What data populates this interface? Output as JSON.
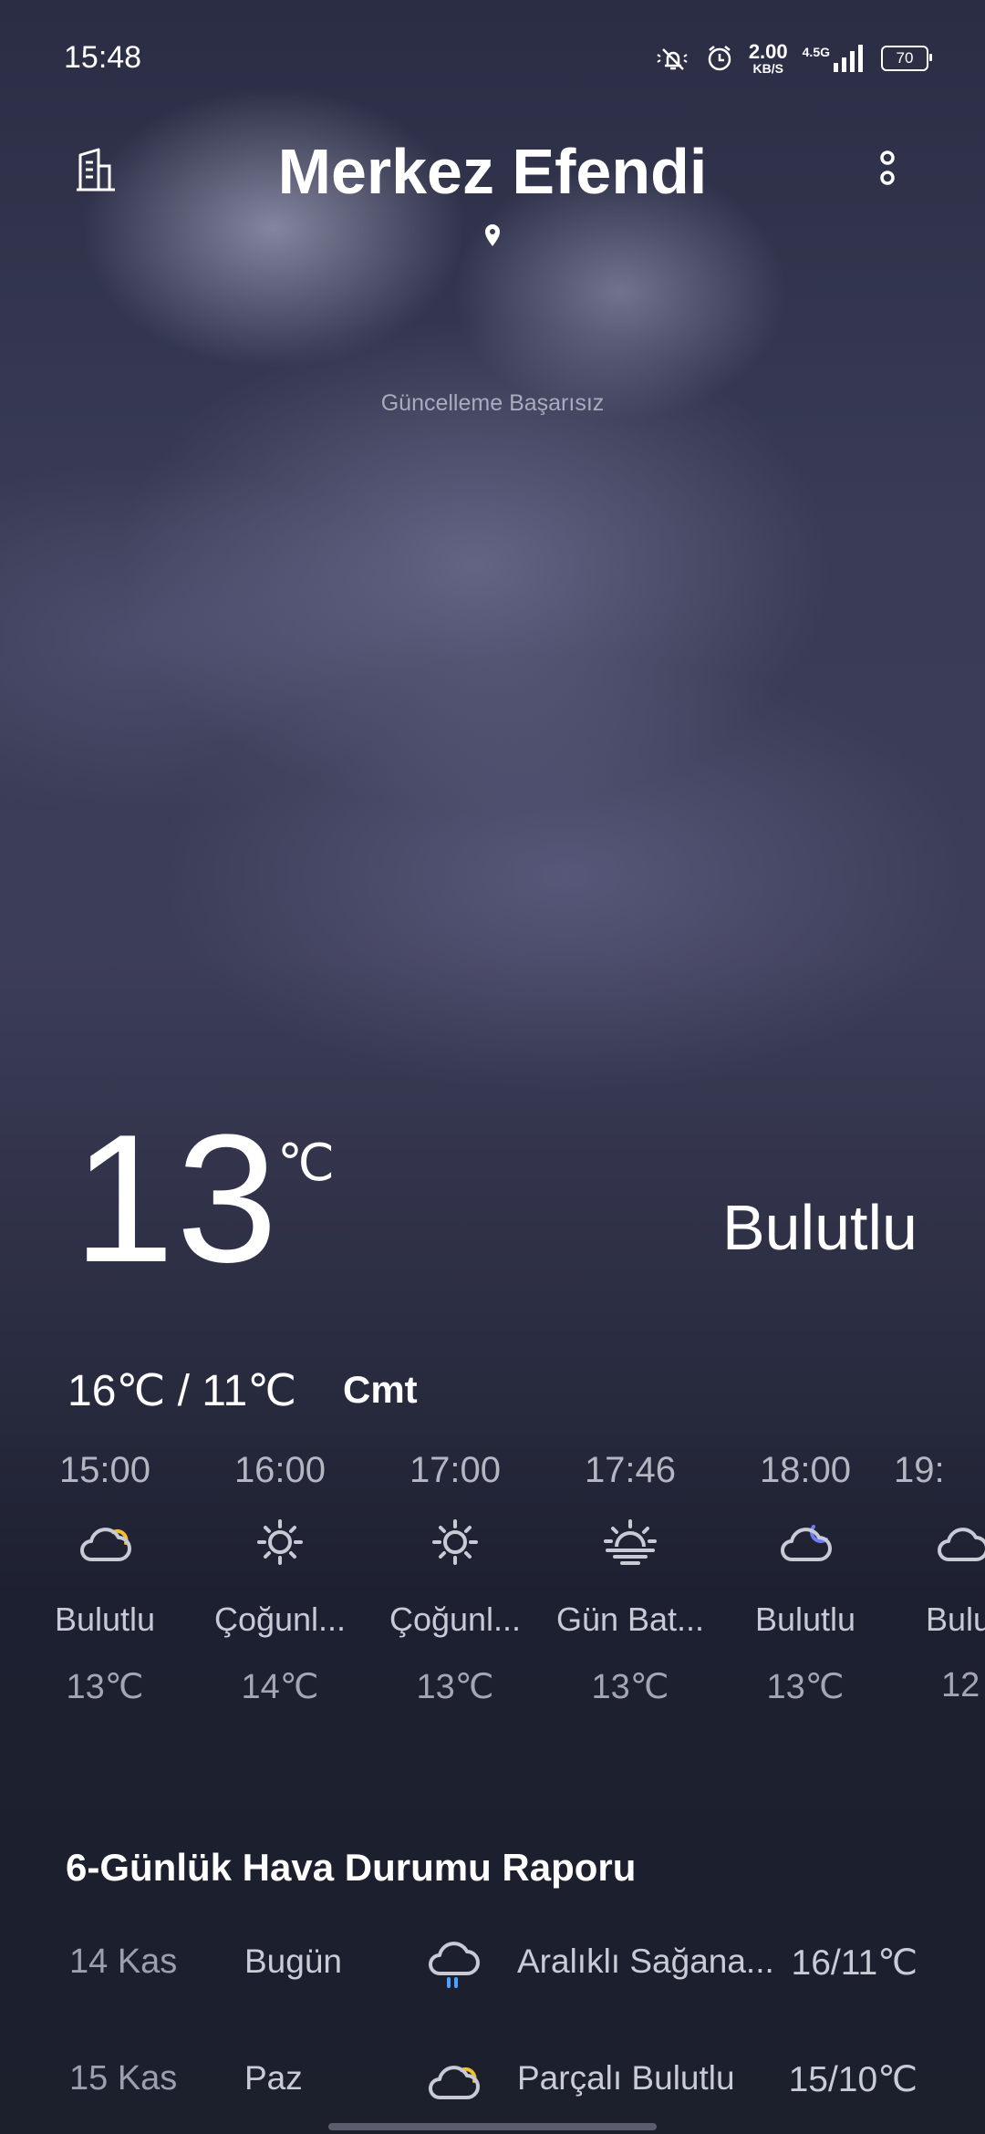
{
  "status": {
    "time": "15:48",
    "speed_value": "2.00",
    "speed_unit": "KB/S",
    "network": "4.5G",
    "battery": "70"
  },
  "header": {
    "city": "Merkez Efendi",
    "update_status": "Güncelleme Başarısız"
  },
  "current": {
    "temperature": "13",
    "unit": "℃",
    "condition": "Bulutlu",
    "high_low": "16℃ / 11℃",
    "day": "Cmt"
  },
  "hourly": [
    {
      "time": "15:00",
      "condition": "Bulutlu",
      "temp": "13℃",
      "icon": "cloud-sun-icon"
    },
    {
      "time": "16:00",
      "condition": "Çoğunl...",
      "temp": "14℃",
      "icon": "sun-icon"
    },
    {
      "time": "17:00",
      "condition": "Çoğunl...",
      "temp": "13℃",
      "icon": "sun-icon"
    },
    {
      "time": "17:46",
      "condition": "Gün Bat...",
      "temp": "13℃",
      "icon": "sunset-icon"
    },
    {
      "time": "18:00",
      "condition": "Bulutlu",
      "temp": "13℃",
      "icon": "cloud-moon-icon"
    },
    {
      "time": "19:",
      "condition": "Bulu",
      "temp": "12",
      "icon": "cloud-icon"
    }
  ],
  "forecast": {
    "title": "6-Günlük Hava Durumu Raporu",
    "rows": [
      {
        "date": "14 Kas",
        "weekday": "Bugün",
        "condition": "Aralıklı Sağana...",
        "range": "16/11℃",
        "icon": "cloud-rain-icon"
      },
      {
        "date": "15 Kas",
        "weekday": "Paz",
        "condition": "Parçalı Bulutlu",
        "range": "15/10℃",
        "icon": "cloud-sun-icon"
      }
    ]
  },
  "colors": {
    "sun_accent": "#f2c12e",
    "moon_accent": "#6f7cf5",
    "rain_accent": "#4aa3ff"
  }
}
